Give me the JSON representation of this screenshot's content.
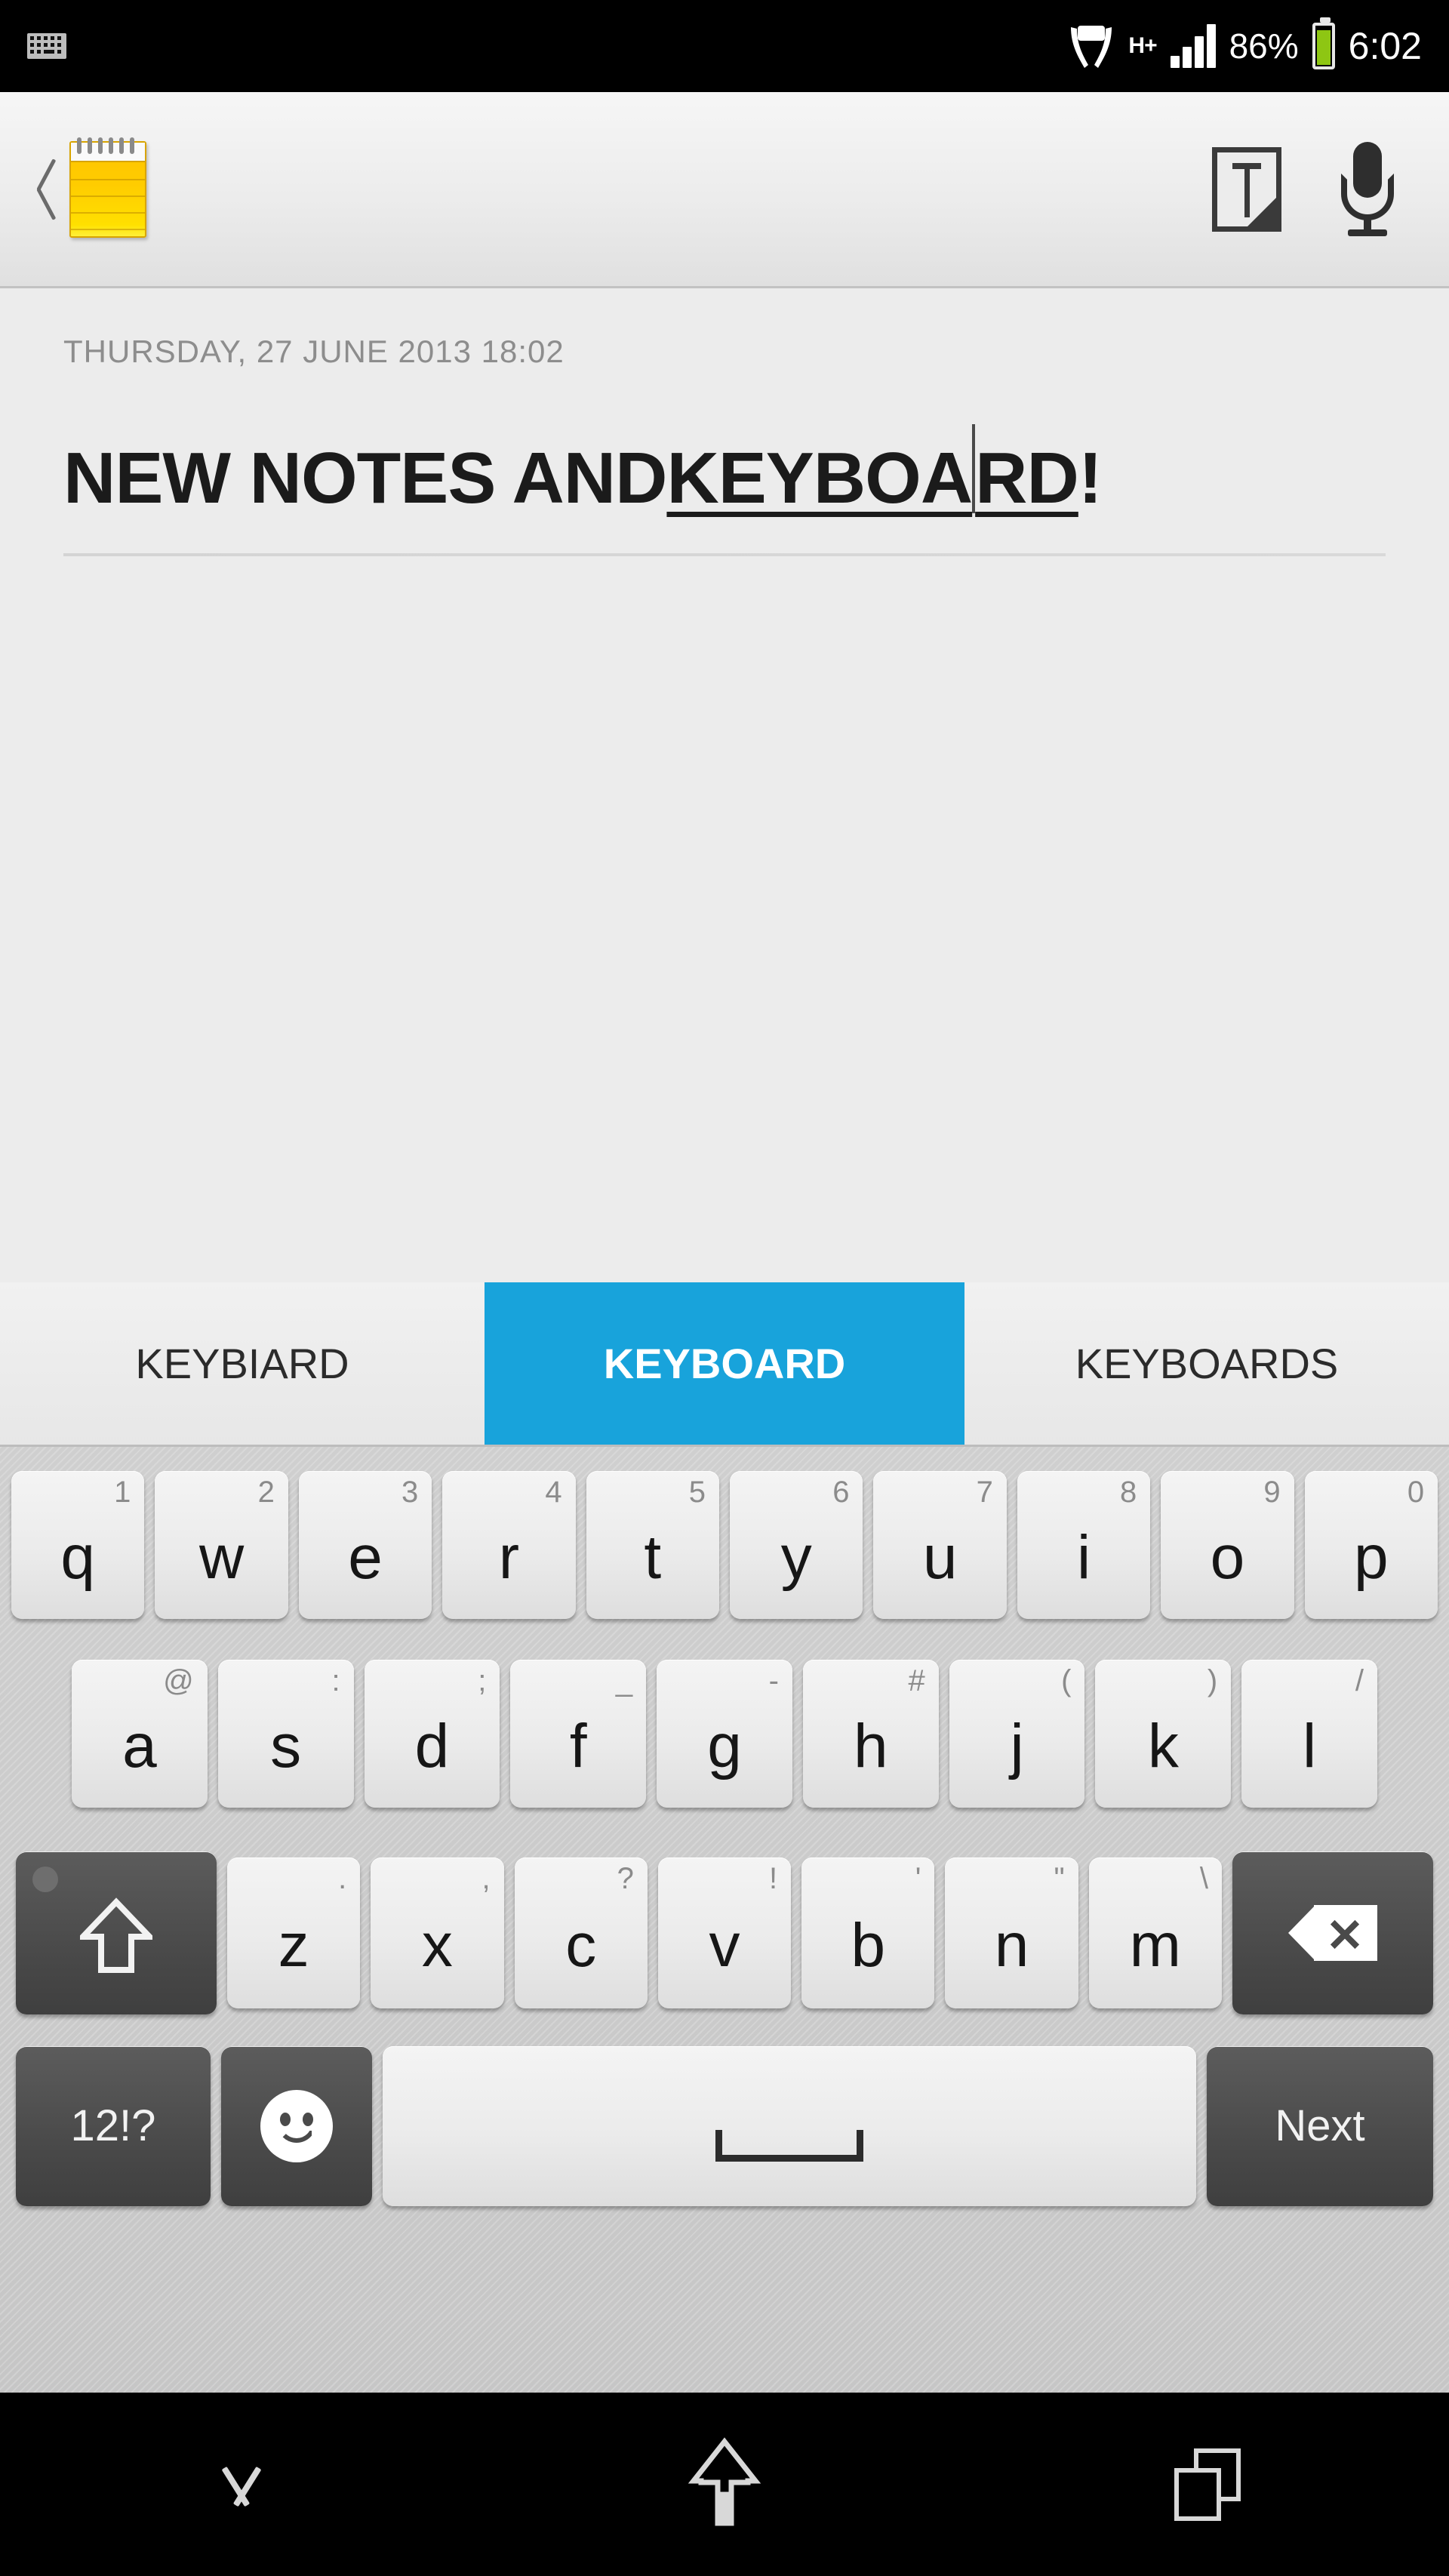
{
  "statusbar": {
    "keyboard_notification_icon": "keyboard-icon",
    "fragile_icon": "handle-with-care-icon",
    "network_type": "H+",
    "signal_icon": "signal-bars-icon",
    "battery_percent": "86%",
    "battery_icon": "battery-icon",
    "clock": "6:02"
  },
  "actionbar": {
    "back_icon": "back-chevron-icon",
    "app_icon": "notepad-icon",
    "text_mode_icon": "text-input-icon",
    "voice_icon": "microphone-icon"
  },
  "note": {
    "date": "THURSDAY, 27 JUNE 2013 18:02",
    "title_plain": "NEW NOTES AND ",
    "title_composing": "KEYBOA",
    "title_composing_tail": "RD",
    "title_end": "!"
  },
  "suggestions": {
    "items": [
      {
        "label": "KEYBIARD",
        "selected": false
      },
      {
        "label": "KEYBOARD",
        "selected": true
      },
      {
        "label": "KEYBOARDS",
        "selected": false
      }
    ],
    "highlight_color": "#18a3db"
  },
  "keyboard": {
    "row1": [
      {
        "main": "q",
        "hint": "1"
      },
      {
        "main": "w",
        "hint": "2"
      },
      {
        "main": "e",
        "hint": "3"
      },
      {
        "main": "r",
        "hint": "4"
      },
      {
        "main": "t",
        "hint": "5"
      },
      {
        "main": "y",
        "hint": "6"
      },
      {
        "main": "u",
        "hint": "7"
      },
      {
        "main": "i",
        "hint": "8"
      },
      {
        "main": "o",
        "hint": "9"
      },
      {
        "main": "p",
        "hint": "0"
      }
    ],
    "row2": [
      {
        "main": "a",
        "hint": "@"
      },
      {
        "main": "s",
        "hint": ":"
      },
      {
        "main": "d",
        "hint": ";"
      },
      {
        "main": "f",
        "hint": "_"
      },
      {
        "main": "g",
        "hint": "-"
      },
      {
        "main": "h",
        "hint": "#"
      },
      {
        "main": "j",
        "hint": "("
      },
      {
        "main": "k",
        "hint": ")"
      },
      {
        "main": "l",
        "hint": "/"
      }
    ],
    "row3": [
      {
        "main": "z",
        "hint": "."
      },
      {
        "main": "x",
        "hint": ","
      },
      {
        "main": "c",
        "hint": "?"
      },
      {
        "main": "v",
        "hint": "!"
      },
      {
        "main": "b",
        "hint": "'"
      },
      {
        "main": "n",
        "hint": "\""
      },
      {
        "main": "m",
        "hint": "\\"
      }
    ],
    "shift_icon": "shift-arrow-icon",
    "backspace_icon": "backspace-icon",
    "symbols_label": "12!?",
    "emoji_icon": "smiley-icon",
    "space_icon": "spacebar-icon",
    "enter_label": "Next"
  },
  "navbar": {
    "down_icon": "hide-keyboard-icon",
    "home_icon": "home-icon",
    "recents_icon": "recent-apps-icon"
  }
}
